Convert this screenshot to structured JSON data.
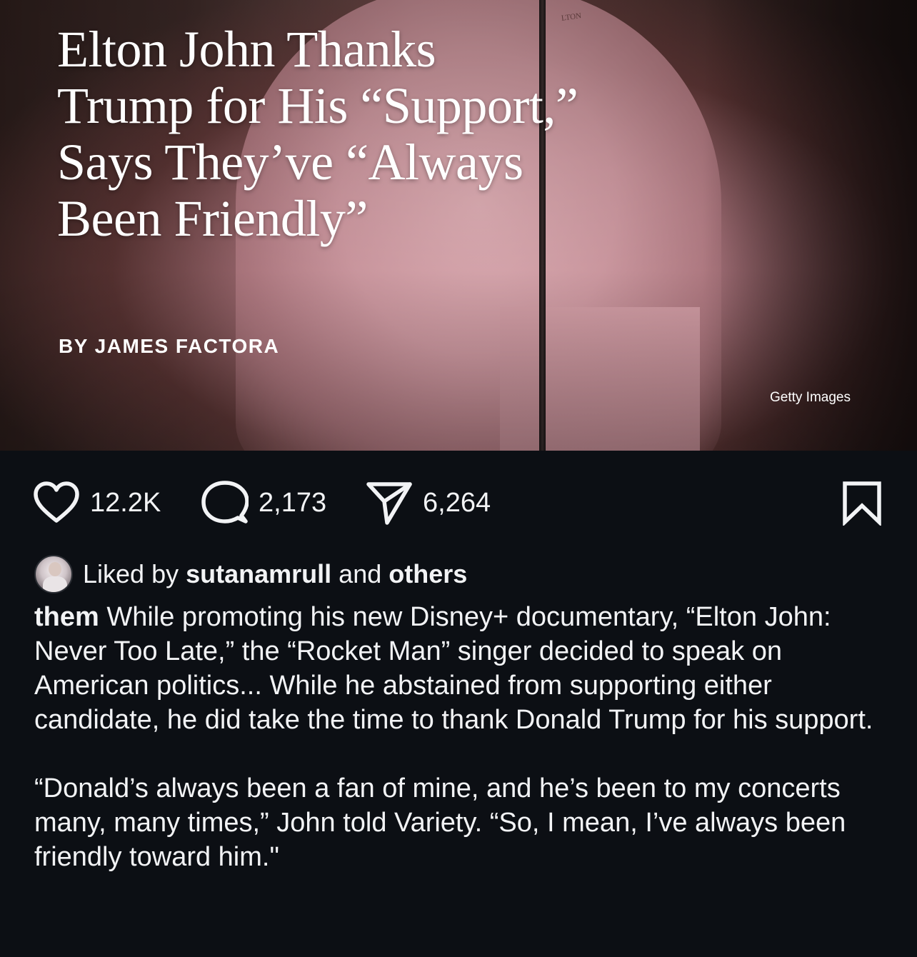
{
  "image": {
    "headline_lines": [
      "Elton John Thanks",
      "Trump for His “Support,”",
      "Says They’ve “Always",
      "Been Friendly”"
    ],
    "byline": "BY JAMES FACTORA",
    "credit": "Getty Images",
    "badge": "LTON"
  },
  "actions": {
    "likes": "12.2K",
    "comments": "2,173",
    "shares": "6,264",
    "like_icon": "heart-icon",
    "comment_icon": "comment-bubble-icon",
    "share_icon": "paper-plane-icon",
    "save_icon": "bookmark-icon"
  },
  "liked_by": {
    "prefix": "Liked by",
    "user": "sutanamrull",
    "middle": "and",
    "others": "others"
  },
  "caption": {
    "username": "them",
    "paragraph1": "While promoting his new Disney+ documentary, “Elton John: Never Too Late,” the “Rocket Man” singer decided to speak on American politics... While he abstained from supporting either candidate, he did take the time to thank Donald Trump for his support.",
    "paragraph2": "“Donald’s always been a fan of mine, and he’s been to my concerts many, many times,” John told Variety. “So, I mean, I’ve always been friendly toward him.\""
  },
  "colors": {
    "background": "#0c0f14",
    "text": "#f2f3f5"
  }
}
